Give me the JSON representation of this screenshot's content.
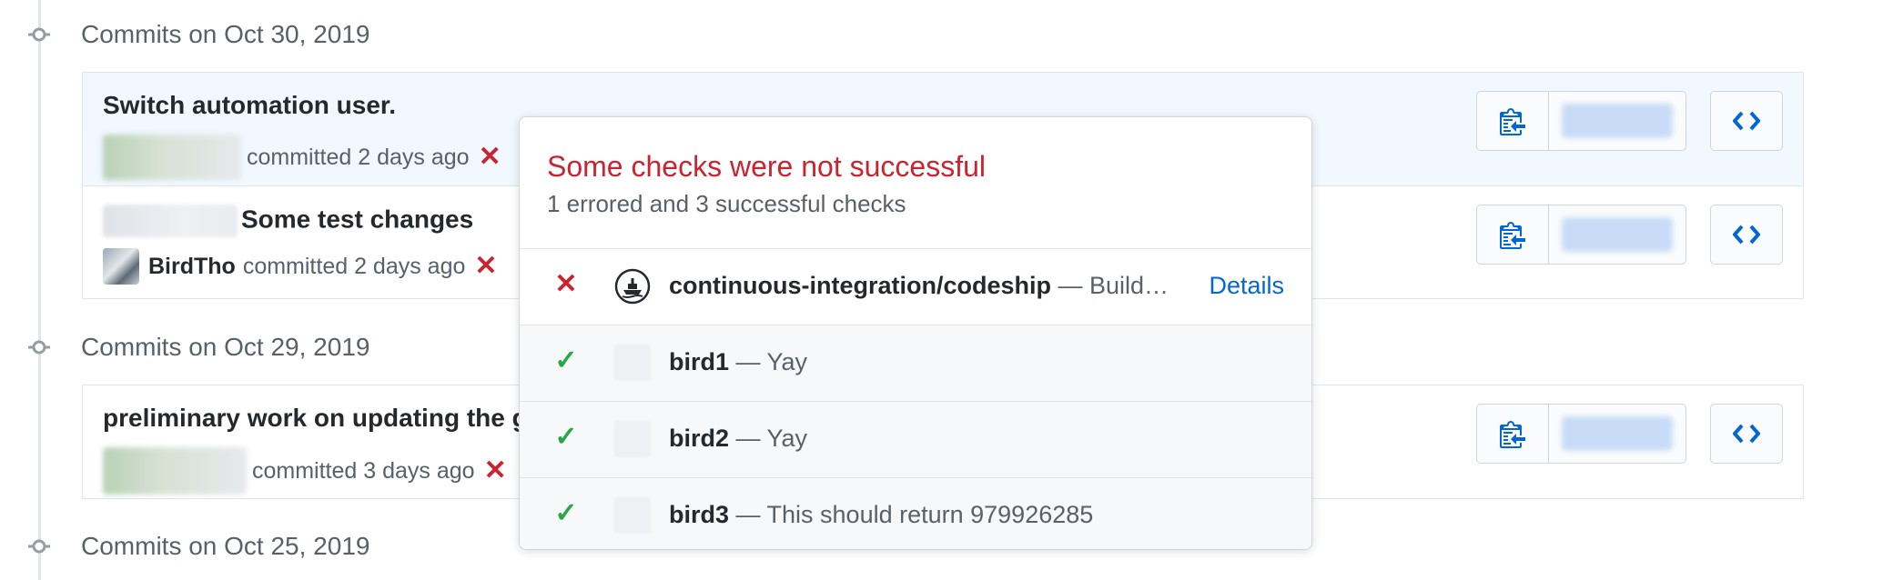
{
  "groups": [
    {
      "heading": "Commits on Oct 30, 2019",
      "commits": [
        {
          "title": "Switch automation user.",
          "author": "",
          "meta": "committed 2 days ago",
          "status": "failure"
        },
        {
          "title": "Some test changes",
          "author": "BirdTho",
          "meta": "committed 2 days ago",
          "status": "failure"
        }
      ]
    },
    {
      "heading": "Commits on Oct 29, 2019",
      "commits": [
        {
          "title": "preliminary work on updating the g",
          "author": "",
          "meta": "committed 3 days ago",
          "status": "failure"
        }
      ]
    },
    {
      "heading": "Commits on Oct 25, 2019"
    }
  ],
  "popover": {
    "title": "Some checks were not successful",
    "subtitle": "1 errored and 3 successful checks",
    "checks": [
      {
        "name": "continuous-integration/codeship",
        "desc": " — Build…",
        "status": "error",
        "link": "Details",
        "icon": "codeship-logo-icon"
      },
      {
        "name": "bird1",
        "desc": " — Yay",
        "status": "success"
      },
      {
        "name": "bird2",
        "desc": " — Yay",
        "status": "success"
      },
      {
        "name": "bird3",
        "desc": " — This should return 979926285",
        "status": "success"
      }
    ]
  },
  "icons": {
    "copy": "clippy-icon",
    "browse": "code-icon",
    "failure": "x-icon",
    "success": "check-icon"
  },
  "colors": {
    "error": "#cb2431",
    "success": "#28a745",
    "link": "#0366d6",
    "highlight_row": "#f1f8ff"
  }
}
